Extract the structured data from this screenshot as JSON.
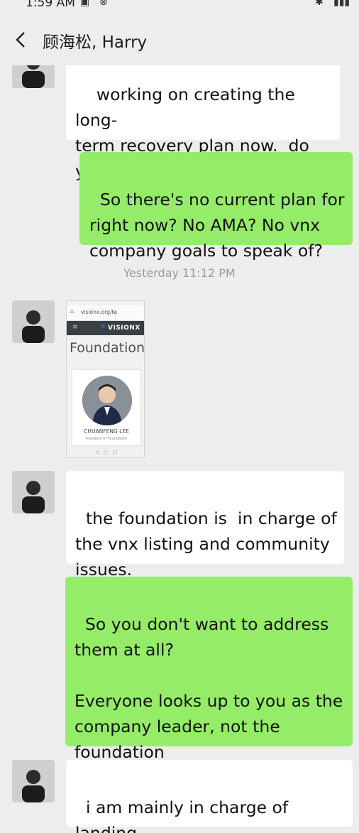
{
  "status_bar": {
    "time": "1:59 AM"
  },
  "header": {
    "title": "顾海松, Harry"
  },
  "messages": [
    {
      "text": "working on creating the long-\nterm recovery plan now.  do\nyou have any good ideas ?"
    },
    {
      "text": "So there's no current plan for\nright now? No AMA? No vnx\ncompany goals to speak of?"
    },
    {
      "text": "the foundation is  in charge of\nthe vnx listing and community\nissues."
    },
    {
      "text": "So you don't want to address\nthem at all?\n\nEveryone looks up to you as the\ncompany leader, not the\nfoundation"
    },
    {
      "text": "i am mainly in charge of landing\nAI solutions."
    }
  ],
  "timestamp": "Yesterday 11:12 PM",
  "shared_image": {
    "url": "visionx.org/te",
    "brand": "VISIONX",
    "heading": "Foundation",
    "person_name": "CHUANFENG LEE",
    "person_role": "President of Foundation"
  },
  "colors": {
    "background": "#ededed",
    "incoming_bubble": "#ffffff",
    "outgoing_bubble": "#95ec69"
  }
}
